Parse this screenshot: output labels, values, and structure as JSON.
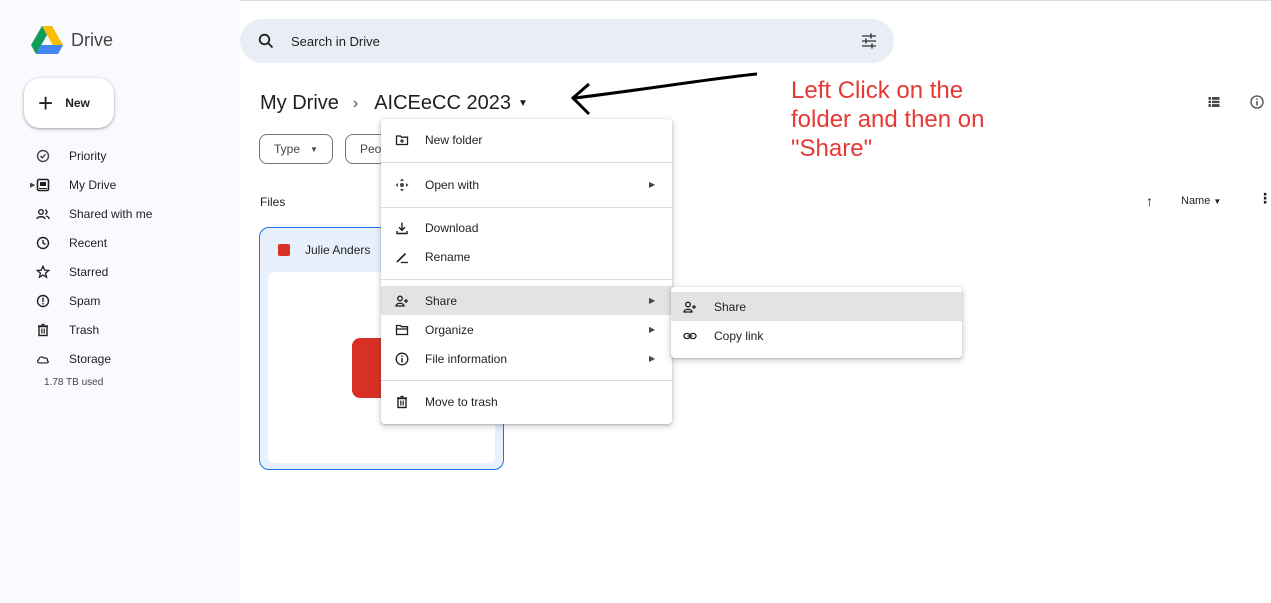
{
  "app": {
    "title": "Drive"
  },
  "sidebar": {
    "new_label": "New",
    "items": [
      {
        "label": "Priority",
        "icon": "priority-icon"
      },
      {
        "label": "My Drive",
        "icon": "my-drive-icon"
      },
      {
        "label": "Shared with me",
        "icon": "shared-icon"
      },
      {
        "label": "Recent",
        "icon": "clock-icon"
      },
      {
        "label": "Starred",
        "icon": "star-icon"
      },
      {
        "label": "Spam",
        "icon": "spam-icon"
      },
      {
        "label": "Trash",
        "icon": "trash-icon"
      },
      {
        "label": "Storage",
        "icon": "cloud-icon"
      }
    ],
    "storage_used": "1.78 TB used"
  },
  "search": {
    "placeholder": "Search in Drive"
  },
  "breadcrumb": {
    "root": "My Drive",
    "current": "AICEeCC 2023"
  },
  "filters": {
    "type": "Type",
    "people": "Peo"
  },
  "files": {
    "label": "Files",
    "sort_label": "Name"
  },
  "card": {
    "name": "Julie Anders"
  },
  "context_menu": {
    "items": [
      {
        "label": "New folder",
        "icon": "new-folder-icon"
      },
      {
        "label": "Open with",
        "icon": "open-with-icon"
      },
      {
        "label": "Download",
        "icon": "download-icon"
      },
      {
        "label": "Rename",
        "icon": "rename-icon"
      },
      {
        "label": "Share",
        "icon": "share-icon"
      },
      {
        "label": "Organize",
        "icon": "organize-icon"
      },
      {
        "label": "File information",
        "icon": "info-icon"
      },
      {
        "label": "Move to trash",
        "icon": "trash-icon"
      }
    ]
  },
  "submenu": {
    "items": [
      {
        "label": "Share",
        "icon": "share-icon"
      },
      {
        "label": "Copy link",
        "icon": "link-icon"
      }
    ]
  },
  "annotation": {
    "line1": "Left Click on the",
    "line2": "folder and then on",
    "line3": "\"Share\"",
    "color": "#e53935"
  },
  "colors": {
    "accent": "#1a73e8",
    "sidebar_bg": "#f8fafd",
    "search_bg": "#e9eef6"
  }
}
